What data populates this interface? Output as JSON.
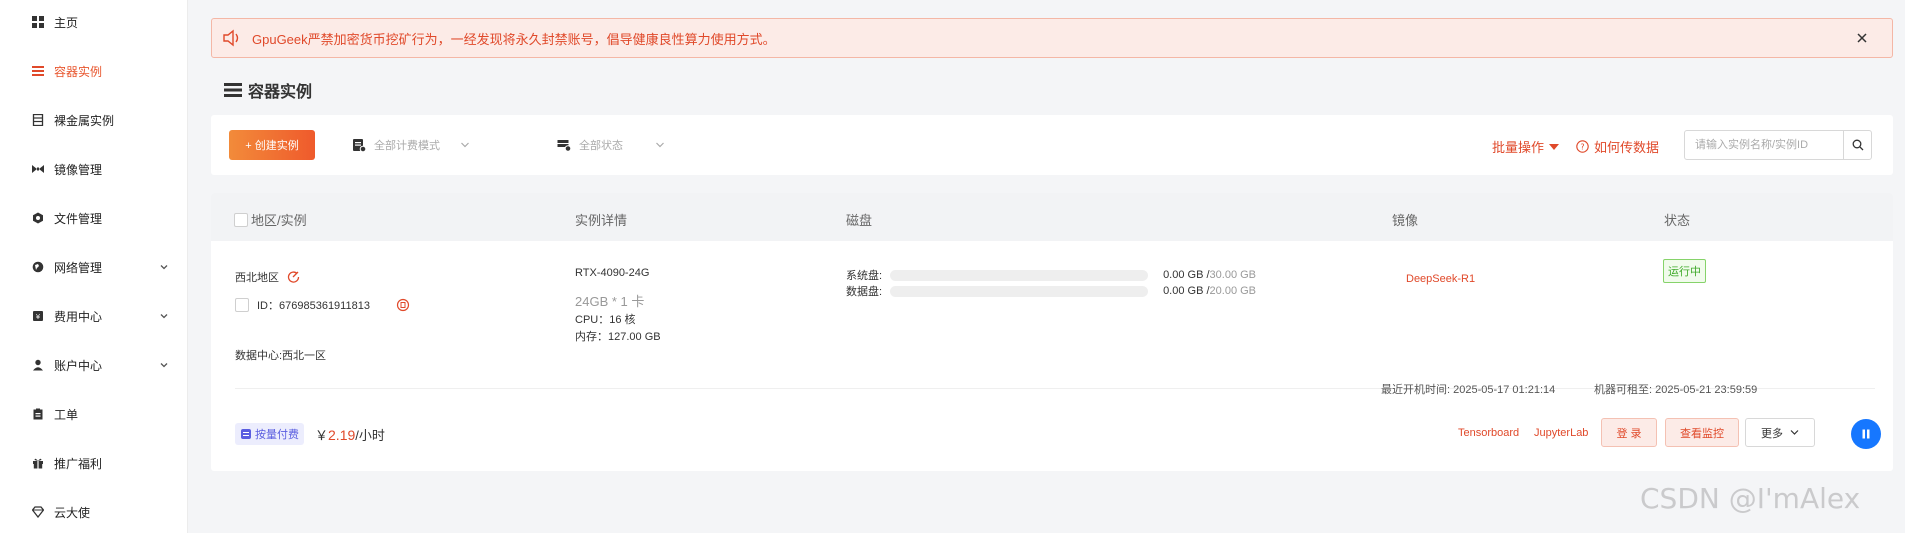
{
  "sidebar": {
    "items": [
      {
        "label": "主页",
        "icon": "grid-icon",
        "active": false
      },
      {
        "label": "容器实例",
        "icon": "menu-lines-icon",
        "active": true
      },
      {
        "label": "裸金属实例",
        "icon": "server-icon",
        "active": false
      },
      {
        "label": "镜像管理",
        "icon": "bowtie-icon",
        "active": false
      },
      {
        "label": "文件管理",
        "icon": "hexagon-icon",
        "active": false
      },
      {
        "label": "网络管理",
        "icon": "globe-icon",
        "active": false,
        "expandable": true
      },
      {
        "label": "费用中心",
        "icon": "wallet-icon",
        "active": false,
        "expandable": true
      },
      {
        "label": "账户中心",
        "icon": "user-icon",
        "active": false,
        "expandable": true
      },
      {
        "label": "工单",
        "icon": "clipboard-icon",
        "active": false
      },
      {
        "label": "推广福利",
        "icon": "gift-icon",
        "active": false
      },
      {
        "label": "云大使",
        "icon": "diamond-icon",
        "active": false
      }
    ]
  },
  "notice": {
    "text": "GpuGeek严禁加密货币挖矿行为，一经发现将永久封禁账号，倡导健康良性算力使用方式。"
  },
  "page": {
    "title": "容器实例"
  },
  "toolbar": {
    "create_label": "+ 创建实例",
    "billing_filter": "全部计费模式",
    "status_filter": "全部状态",
    "batch_label": "批量操作",
    "howto_label": "如何传数据",
    "search_placeholder": "请输入实例名称/实例ID"
  },
  "table": {
    "headers": {
      "region": "地区/实例",
      "details": "实例详情",
      "disk": "磁盘",
      "image": "镜像",
      "status": "状态"
    },
    "row": {
      "region": "西北地区",
      "id_label": "ID：676985361911813",
      "datacenter": "数据中心:西北一区",
      "gpu": "RTX-4090-24G",
      "gpu_count": "24GB * 1 卡",
      "cpu": "CPU：16 核",
      "memory": "内存：127.00 GB",
      "system_disk_label": "系统盘:",
      "system_disk_used": "0.00 GB / ",
      "system_disk_total": "30.00 GB",
      "system_disk_fraction": 0,
      "data_disk_label": "数据盘:",
      "data_disk_used": "0.00 GB / ",
      "data_disk_total": "20.00 GB",
      "data_disk_fraction": 0,
      "image": "DeepSeek-R1",
      "status": "运行中",
      "last_boot": "最近开机时间:   2025-05-17 01:21:14",
      "rentable_until": "机器可租至:   2025-05-21 23:59:59",
      "billing_tag": "按量付费",
      "price_prefix": "￥",
      "price_value": "2.19",
      "price_unit": "/小时",
      "tensorboard": "Tensorboard",
      "jupyterlab": "JupyterLab",
      "login": "登 录",
      "monitor": "查看监控",
      "more": "更多"
    }
  },
  "watermark": "CSDN @I'mAlex",
  "colors": {
    "accent": "#e0492a",
    "create_gradient_start": "#f28b3a",
    "create_gradient_end": "#ef5a2c",
    "status_green": "#3faa2a",
    "pause_blue": "#1677ff"
  }
}
